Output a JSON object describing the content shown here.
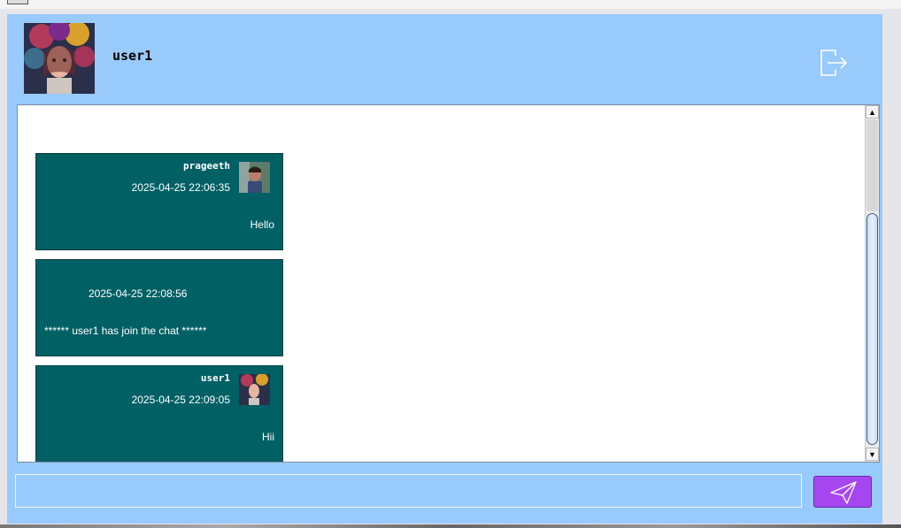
{
  "header": {
    "username": "user1",
    "avatar_icon": "user-avatar-portrait",
    "logout_icon": "logout-icon"
  },
  "messages": [
    {
      "sender": "prageeth",
      "time": "2025-04-25 22:06:35",
      "text": "Hello",
      "avatar_icon": "prageeth-avatar"
    },
    {
      "sender": "",
      "time": "2025-04-25 22:08:56",
      "text": "****** user1 has join the chat ******"
    },
    {
      "sender": "user1",
      "time": "2025-04-25 22:09:05",
      "text": "Hii",
      "avatar_icon": "user1-avatar"
    }
  ],
  "composer": {
    "value": "",
    "send_icon": "paper-plane-icon"
  },
  "colors": {
    "panel": "#99cafc",
    "bubble": "#006064",
    "send": "#a646f0"
  }
}
